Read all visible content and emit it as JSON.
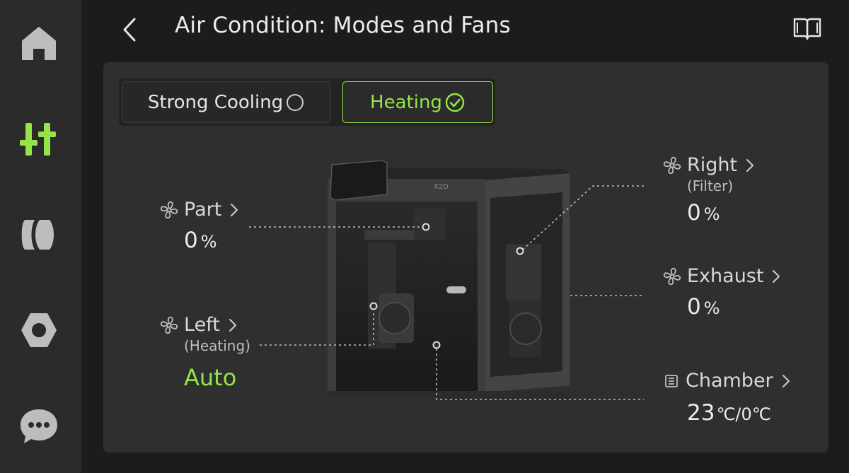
{
  "header": {
    "title": "Air Condition: Modes and Fans"
  },
  "modes": {
    "strong_cooling_label": "Strong Cooling",
    "heating_label": "Heating",
    "selected": "Heating"
  },
  "fans": {
    "part": {
      "label": "Part",
      "value": "0",
      "unit": "%"
    },
    "left": {
      "label": "Left",
      "sublabel": "(Heating)",
      "value": "Auto"
    },
    "right": {
      "label": "Right",
      "sublabel": "(Filter)",
      "value": "0",
      "unit": "%"
    },
    "exhaust": {
      "label": "Exhaust",
      "value": "0",
      "unit": "%"
    }
  },
  "chamber": {
    "label": "Chamber",
    "current": "23",
    "current_unit": "℃/",
    "target": "0",
    "target_unit": "℃"
  },
  "printer": {
    "brand_mark": "X2D"
  },
  "sidebar": {
    "items": [
      {
        "name": "home",
        "icon": "home-icon"
      },
      {
        "name": "controls",
        "icon": "sliders-icon",
        "active": true
      },
      {
        "name": "filament",
        "icon": "filament-spool-icon"
      },
      {
        "name": "settings",
        "icon": "hex-nut-icon"
      },
      {
        "name": "messages",
        "icon": "chat-bubble-icon"
      }
    ]
  },
  "colors": {
    "accent": "#95e44a",
    "sidebar_bg": "#2b2b2b",
    "panel_bg": "#2f2f2f",
    "page_bg": "#1c1c1c"
  }
}
